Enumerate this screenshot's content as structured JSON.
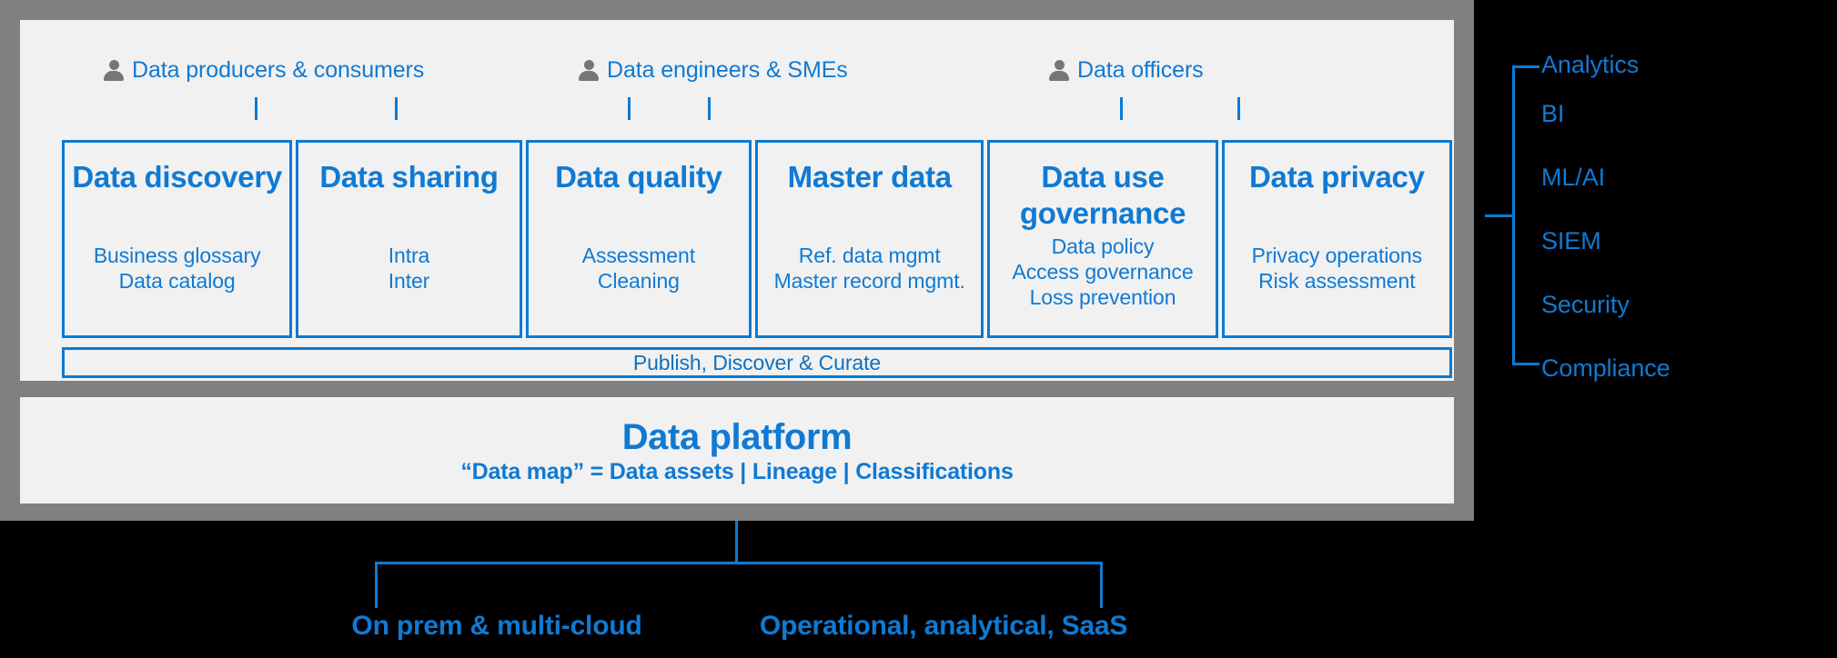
{
  "colors": {
    "accent_blue": "#0f7ad4",
    "line_blue": "#0a7bd4",
    "frame_gray": "#808080",
    "panel_gray": "#f1f1f1",
    "icon_gray": "#767676",
    "background": "#000000"
  },
  "personas": [
    {
      "label": "Data producers & consumers",
      "icon": "person-icon"
    },
    {
      "label": "Data engineers & SMEs",
      "icon": "person-icon"
    },
    {
      "label": "Data officers",
      "icon": "person-icon"
    }
  ],
  "cards": [
    {
      "title": "Data discovery",
      "subs": [
        "Business glossary",
        "Data catalog"
      ]
    },
    {
      "title": "Data sharing",
      "subs": [
        "Intra",
        "Inter"
      ]
    },
    {
      "title": "Data quality",
      "subs": [
        "Assessment",
        "Cleaning"
      ]
    },
    {
      "title": "Master data",
      "subs": [
        "Ref. data mgmt",
        "Master record mgmt."
      ]
    },
    {
      "title": "Data use governance",
      "subs": [
        "Data policy",
        "Access governance",
        "Loss prevention"
      ]
    },
    {
      "title": "Data privacy",
      "subs": [
        "Privacy operations",
        "Risk assessment"
      ]
    }
  ],
  "publish_bar": {
    "label": "Publish, Discover & Curate"
  },
  "platform": {
    "title": "Data platform",
    "subtitle": "“Data map” = Data assets | Lineage | Classifications"
  },
  "consumers": [
    {
      "label": "Analytics"
    },
    {
      "label": "BI"
    },
    {
      "label": "ML/AI"
    },
    {
      "label": "SIEM"
    },
    {
      "label": "Security"
    },
    {
      "label": "Compliance"
    }
  ],
  "deployment": [
    {
      "label": "On prem & multi-cloud"
    },
    {
      "label": "Operational, analytical, SaaS"
    }
  ]
}
